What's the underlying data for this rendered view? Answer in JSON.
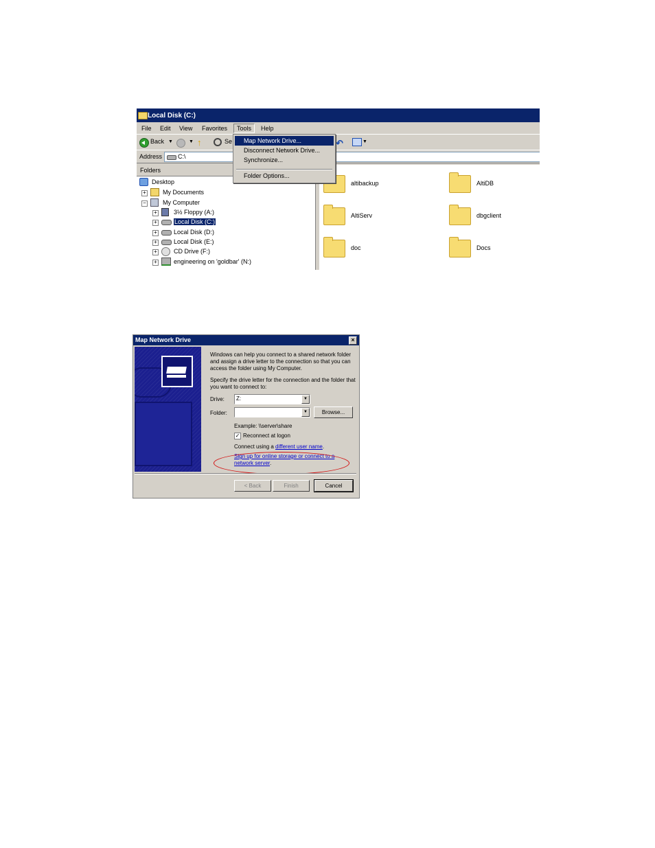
{
  "explorer": {
    "title": "Local Disk (C:)",
    "menu": [
      "File",
      "Edit",
      "View",
      "Favorites",
      "Tools",
      "Help"
    ],
    "toolbar": {
      "back": "Back",
      "search": "Se"
    },
    "address": {
      "label": "Address",
      "value": "C:\\"
    },
    "folders_label": "Folders",
    "tree": [
      {
        "label": "Desktop",
        "icon": "desktop-icon"
      },
      {
        "label": "My Documents",
        "icon": "documents-icon"
      },
      {
        "label": "My Computer",
        "icon": "computer-icon"
      },
      {
        "label": "3½ Floppy (A:)",
        "icon": "floppy-icon"
      },
      {
        "label": "Local Disk (C:)",
        "icon": "disk-icon",
        "selected": true
      },
      {
        "label": "Local Disk (D:)",
        "icon": "disk-icon"
      },
      {
        "label": "Local Disk (E:)",
        "icon": "disk-icon"
      },
      {
        "label": "CD Drive (F:)",
        "icon": "cd-icon"
      },
      {
        "label": "engineering on 'goldbar' (N:)",
        "icon": "network-drive-icon"
      }
    ],
    "files": [
      "altibackup",
      "AltiDB",
      "AltiServ",
      "dbgclient",
      "doc",
      "Docs"
    ],
    "tools_menu": [
      "Map Network Drive...",
      "Disconnect Network Drive...",
      "Synchronize...",
      "Folder Options..."
    ]
  },
  "dialog": {
    "title": "Map Network Drive",
    "intro": "Windows can help you connect to a shared network folder and assign a drive letter to the connection so that you can access the folder using My Computer.",
    "specify": "Specify the drive letter for the connection and the folder that you want to connect to:",
    "drive_label": "Drive:",
    "drive_value": "Z:",
    "folder_label": "Folder:",
    "folder_value": "",
    "browse": "Browse...",
    "example": "Example: \\\\server\\share",
    "reconnect": "Reconnect at logon",
    "reconnect_checked": true,
    "connect_prefix": "Connect using a ",
    "connect_link": "different user name",
    "connect_suffix": ".",
    "signup_link": "Sign up for online storage or connect to a network server",
    "signup_suffix": ".",
    "back_button": "< Back",
    "finish_button": "Finish",
    "cancel_button": "Cancel",
    "highlight_color": "#d41010"
  }
}
